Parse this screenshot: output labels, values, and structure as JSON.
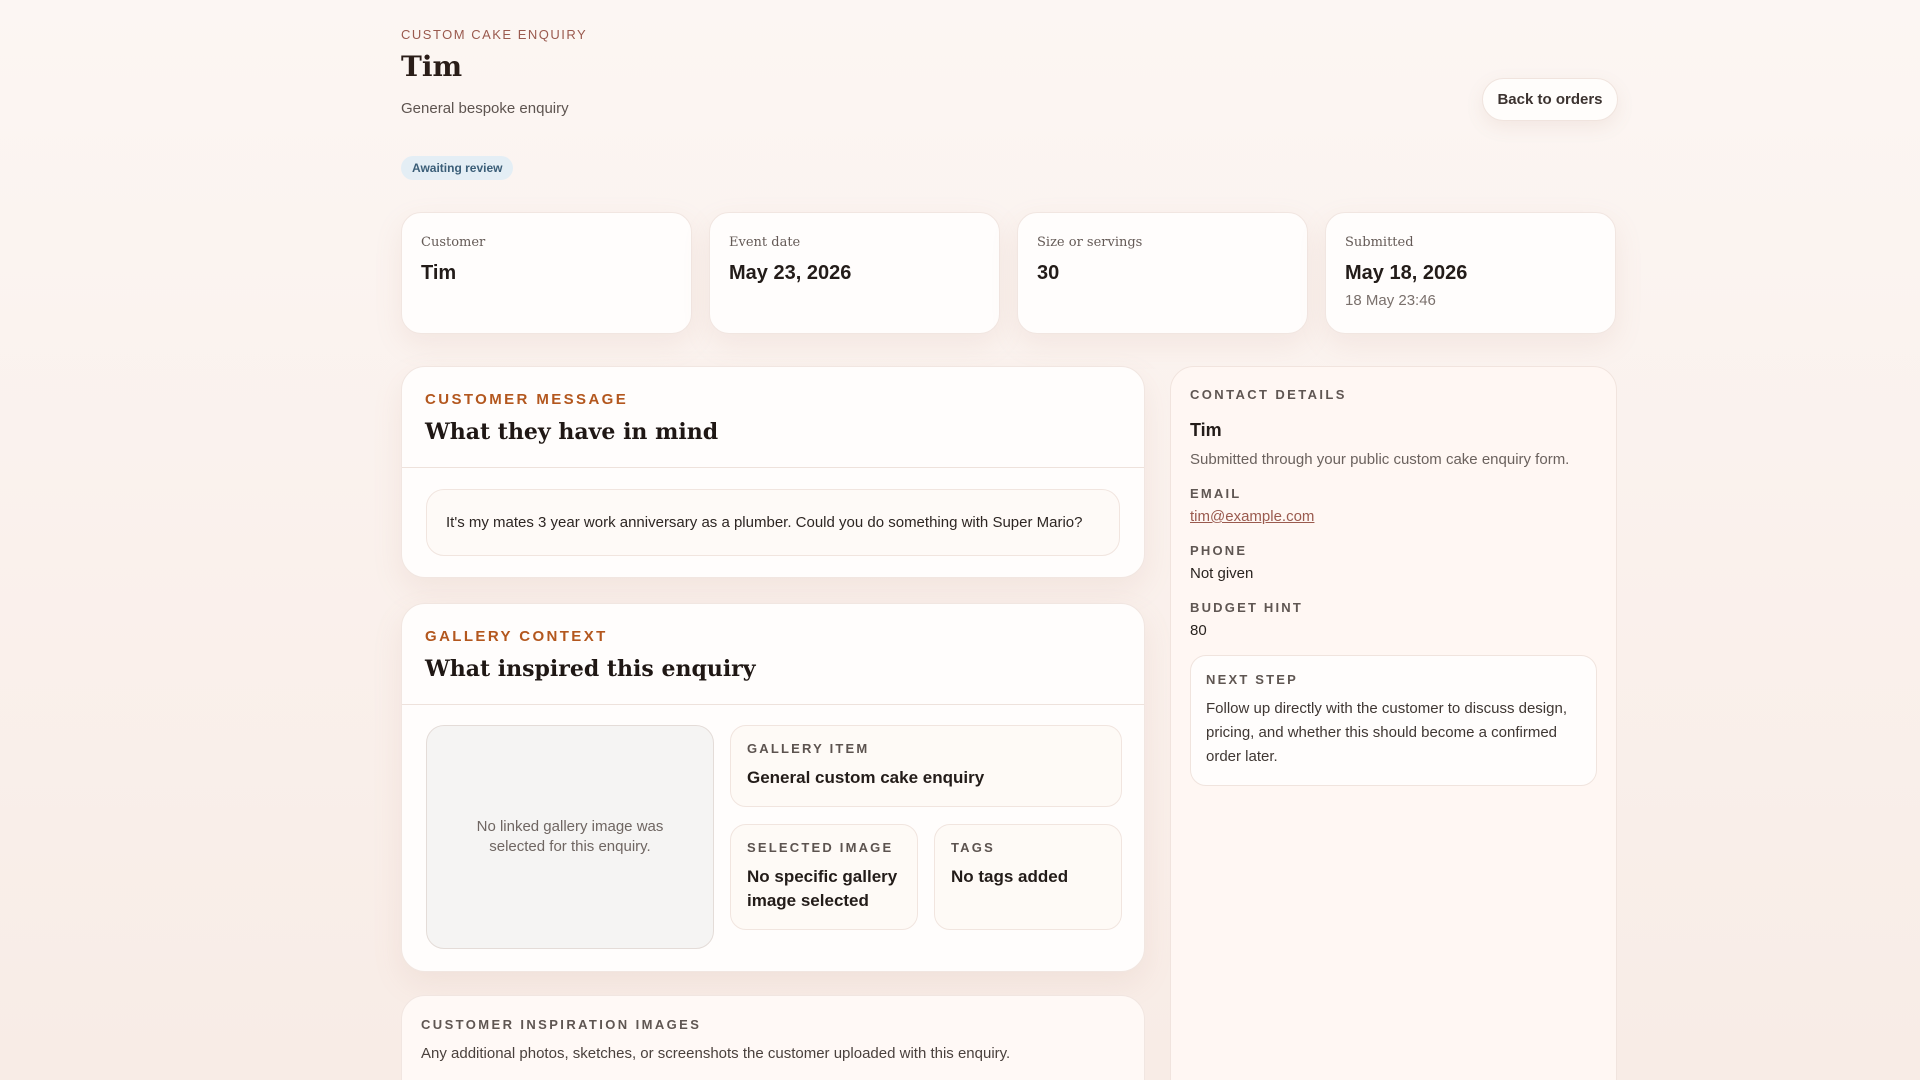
{
  "header": {
    "eyebrow": "CUSTOM CAKE ENQUIRY",
    "title": "Tim",
    "subtitle": "General bespoke enquiry",
    "back_label": "Back to orders",
    "status": "Awaiting review"
  },
  "stats": [
    {
      "label": "Customer",
      "value": "Tim",
      "sub": ""
    },
    {
      "label": "Event date",
      "value": "May 23, 2026",
      "sub": ""
    },
    {
      "label": "Size or servings",
      "value": "30",
      "sub": ""
    },
    {
      "label": "Submitted",
      "value": "May 18, 2026",
      "sub": "18 May 23:46"
    }
  ],
  "message": {
    "eyebrow": "CUSTOMER MESSAGE",
    "title": "What they have in mind",
    "text": "It's my mates 3 year work anniversary as a plumber. Could you do something with Super Mario?"
  },
  "gallery": {
    "eyebrow": "GALLERY CONTEXT",
    "title": "What inspired this enquiry",
    "image_placeholder": "No linked gallery image was selected for this enquiry.",
    "item_label": "GALLERY ITEM",
    "item_value": "General custom cake enquiry",
    "selected_label": "SELECTED IMAGE",
    "selected_value": "No specific gallery image selected",
    "tags_label": "TAGS",
    "tags_value": "No tags added"
  },
  "inspiration": {
    "eyebrow": "CUSTOMER INSPIRATION IMAGES",
    "text": "Any additional photos, sketches, or screenshots the customer uploaded with this enquiry."
  },
  "contact": {
    "eyebrow": "CONTACT DETAILS",
    "name": "Tim",
    "desc": "Submitted through your public custom cake enquiry form.",
    "email_label": "EMAIL",
    "email": "tim@example.com",
    "phone_label": "PHONE",
    "phone": "Not given",
    "budget_label": "BUDGET HINT",
    "budget": "80",
    "next_label": "NEXT STEP",
    "next_text": "Follow up directly with the customer to discuss design, pricing, and whether this should become a confirmed order later."
  },
  "colors": {
    "accent": "#b3571e",
    "badge_bg": "#e4eef5",
    "badge_text": "#3b5e78",
    "link": "#9a5a4e"
  }
}
